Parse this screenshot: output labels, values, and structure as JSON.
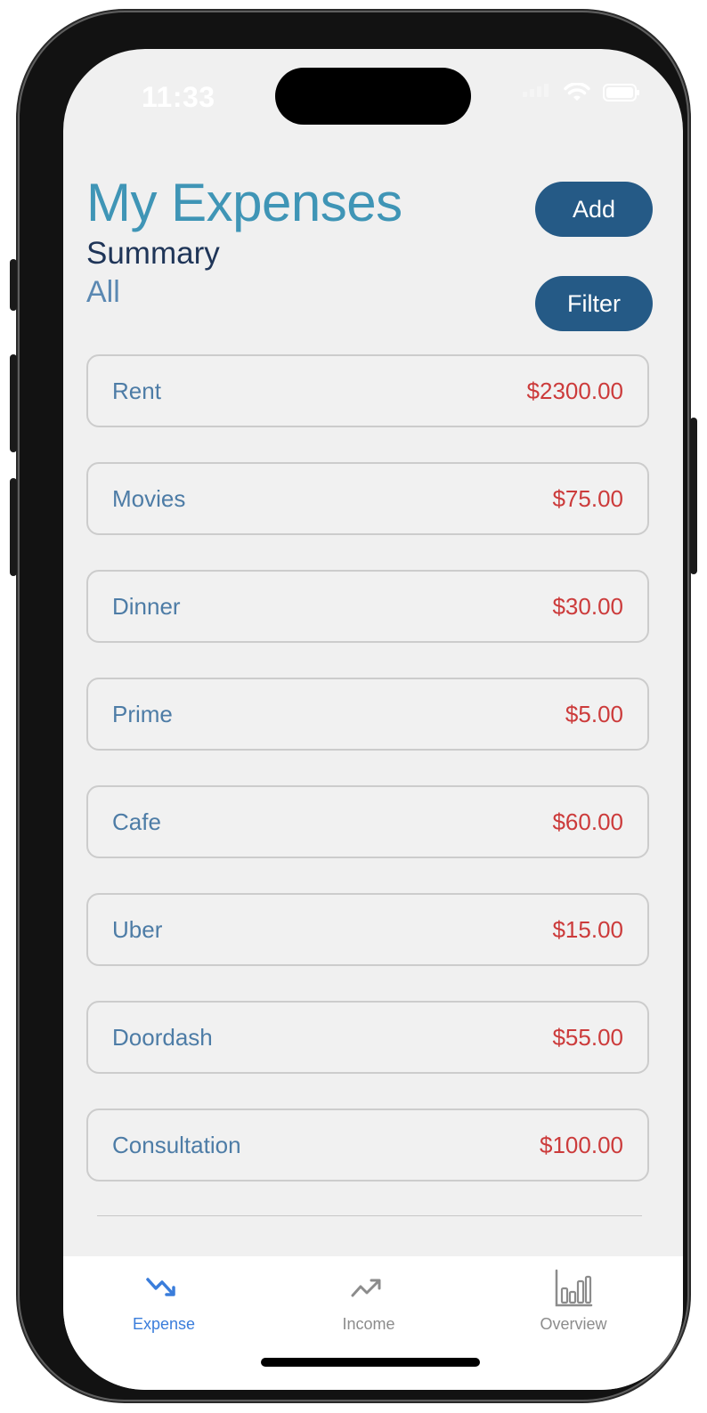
{
  "status": {
    "time": "11:33"
  },
  "header": {
    "title": "My Expenses",
    "subtitle": "Summary",
    "filter_value": "All",
    "add_label": "Add",
    "filter_label": "Filter"
  },
  "expenses": [
    {
      "name": "Rent",
      "amount": "$2300.00"
    },
    {
      "name": "Movies",
      "amount": "$75.00"
    },
    {
      "name": "Dinner",
      "amount": "$30.00"
    },
    {
      "name": "Prime",
      "amount": "$5.00"
    },
    {
      "name": "Cafe",
      "amount": "$60.00"
    },
    {
      "name": "Uber",
      "amount": "$15.00"
    },
    {
      "name": "Doordash",
      "amount": "$55.00"
    },
    {
      "name": "Consultation",
      "amount": "$100.00"
    }
  ],
  "tabs": [
    {
      "label": "Expense",
      "icon": "trend-down-icon",
      "active": true
    },
    {
      "label": "Income",
      "icon": "trend-up-icon",
      "active": false
    },
    {
      "label": "Overview",
      "icon": "bar-chart-icon",
      "active": false
    }
  ],
  "colors": {
    "title": "#3f95b6",
    "button": "#255a86",
    "amount": "#cc3b3b",
    "item_name": "#4d7ca6",
    "tab_active": "#3a7ddb",
    "tab_inactive": "#8c8c8c"
  }
}
